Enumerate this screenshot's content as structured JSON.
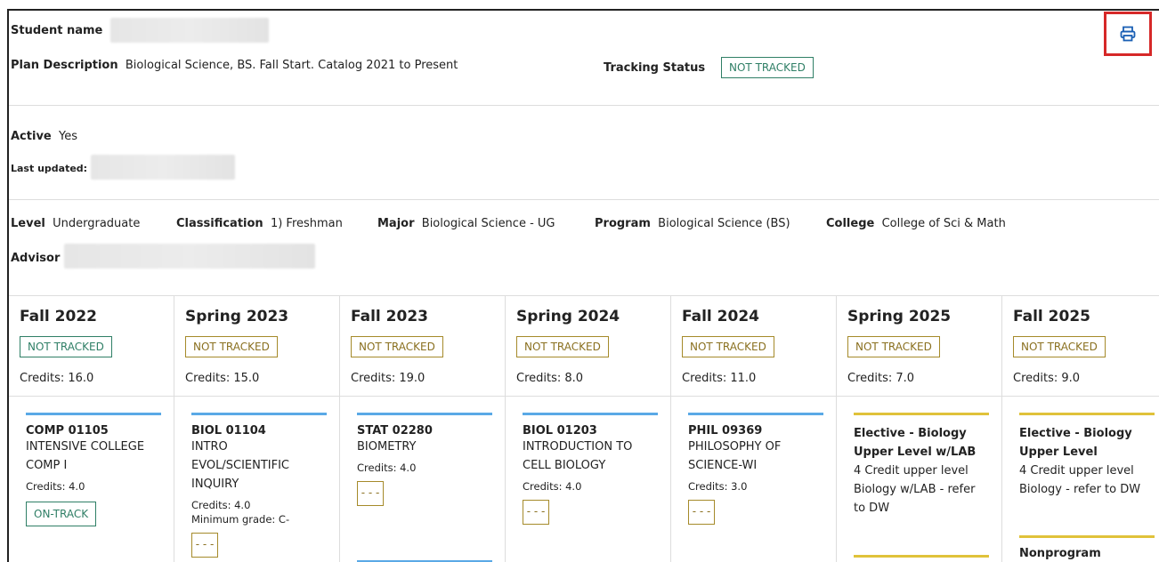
{
  "header": {
    "student_name_label": "Student name",
    "plan_description_label": "Plan Description",
    "plan_description_value": "Biological Science, BS. Fall Start. Catalog 2021 to Present",
    "tracking_status_label": "Tracking Status",
    "tracking_status_value": "NOT TRACKED",
    "print_icon": "printer-icon"
  },
  "info": {
    "active_label": "Active",
    "active_value": "Yes",
    "last_updated_label": "Last updated:",
    "level_label": "Level",
    "level_value": "Undergraduate",
    "classification_label": "Classification",
    "classification_value": "1) Freshman",
    "major_label": "Major",
    "major_value": "Biological Science - UG",
    "program_label": "Program",
    "program_value": "Biological Science (BS)",
    "college_label": "College",
    "college_value": "College of Sci & Math",
    "advisor_label": "Advisor"
  },
  "terms": [
    {
      "name": "Fall 2022",
      "status": "NOT TRACKED",
      "credits": "Credits:  16.0",
      "course": {
        "code": "COMP 01105",
        "title": "INTENSIVE COLLEGE COMP I",
        "credits": "Credits:  4.0",
        "status": "ON-TRACK"
      }
    },
    {
      "name": "Spring 2023",
      "status": "NOT TRACKED",
      "credits": "Credits:  15.0",
      "course": {
        "code": "BIOL 01104",
        "title": "INTRO EVOL/SCIENTIFIC INQUIRY",
        "credits": "Credits:  4.0",
        "min_grade": "Minimum grade:  C-",
        "status": "- - -"
      }
    },
    {
      "name": "Fall 2023",
      "status": "NOT TRACKED",
      "credits": "Credits:  19.0",
      "course": {
        "code": "STAT 02280",
        "title": "BIOMETRY",
        "credits": "Credits:  4.0",
        "status": "- - -"
      }
    },
    {
      "name": "Spring 2024",
      "status": "NOT TRACKED",
      "credits": "Credits:  8.0",
      "course": {
        "code": "BIOL 01203",
        "title": "INTRODUCTION TO CELL BIOLOGY",
        "credits": "Credits:  4.0",
        "status": "- - -"
      }
    },
    {
      "name": "Fall 2024",
      "status": "NOT TRACKED",
      "credits": "Credits:  11.0",
      "course": {
        "code": "PHIL 09369",
        "title": "PHILOSOPHY OF SCIENCE-WI",
        "credits": "Credits:  3.0",
        "status": "- - -"
      }
    },
    {
      "name": "Spring 2025",
      "status": "NOT TRACKED",
      "credits": "Credits:  7.0",
      "course": {
        "code": "Elective - Biology Upper Level w/LAB",
        "title": "4 Credit upper level Biology w/LAB - refer to DW"
      }
    },
    {
      "name": "Fall 2025",
      "status": "NOT TRACKED",
      "credits": "Credits:  9.0",
      "course": {
        "code": "Elective - Biology Upper Level",
        "title": "4 Credit upper level Biology - refer to DW"
      },
      "course2": {
        "code": "Nonprogram"
      }
    }
  ],
  "colors": {
    "accent_green": "#2f7f66",
    "accent_gold": "#a58a2a",
    "print_highlight": "#d62828",
    "line_blue": "#5aa9e6",
    "line_gold": "#e0c23a"
  }
}
